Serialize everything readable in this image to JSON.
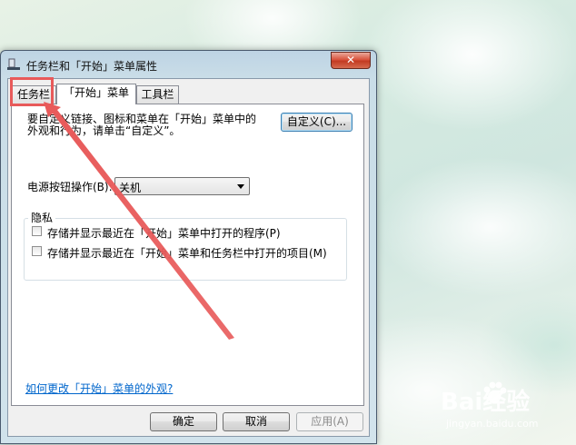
{
  "window": {
    "title": "任务栏和「开始」菜单属性",
    "close_label": "✕"
  },
  "tabs": [
    {
      "label": "任务栏"
    },
    {
      "label": "「开始」菜单"
    },
    {
      "label": "工具栏"
    }
  ],
  "panel": {
    "description": "要自定义链接、图标和菜单在「开始」菜单中的外观和行为，请单击“自定义”。",
    "customize_button": "自定义(C)...",
    "power_label": "电源按钮操作(B):",
    "power_value": "关机",
    "privacy_title": "隐私",
    "privacy_items": [
      {
        "label": "存储并显示最近在「开始」菜单中打开的程序(P)",
        "checked": false
      },
      {
        "label": "存储并显示最近在「开始」菜单和任务栏中打开的项目(M)",
        "checked": false
      }
    ],
    "help_link": "如何更改「开始」菜单的外观?"
  },
  "footer": {
    "ok": "确定",
    "cancel": "取消",
    "apply": "应用(A)"
  },
  "watermark": {
    "brand": "Bai经验",
    "url": "jingyan.baidu.com"
  },
  "annotation": {
    "color": "#e85a5a"
  }
}
